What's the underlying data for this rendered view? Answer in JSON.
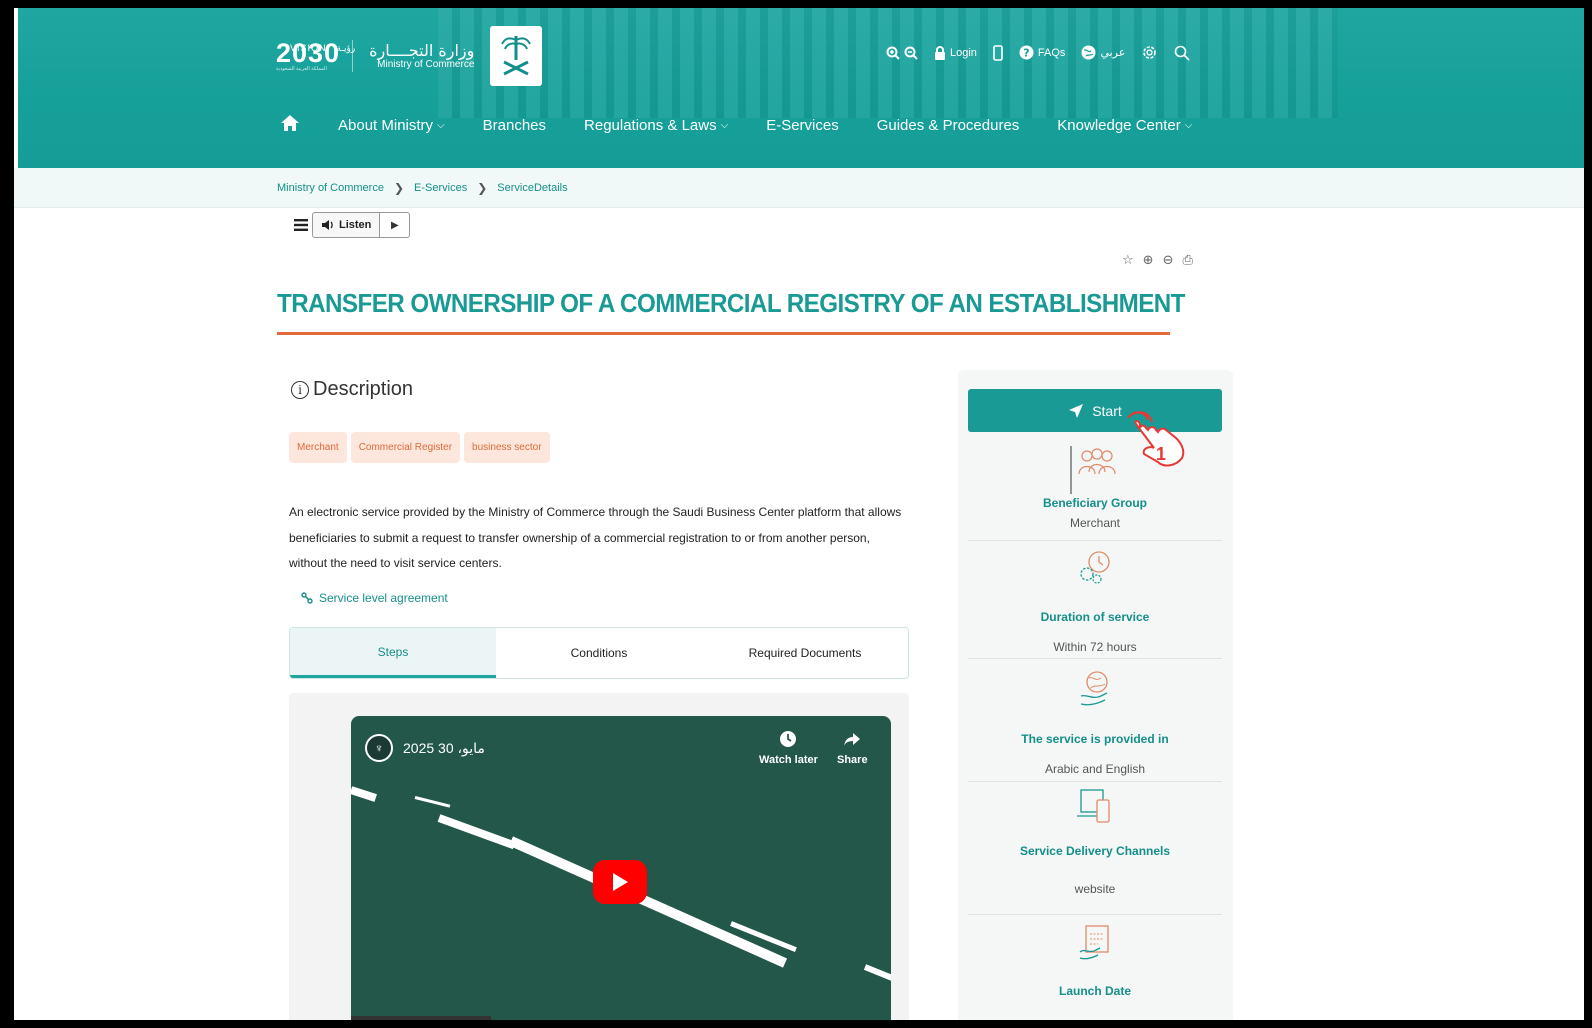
{
  "header": {
    "vision_top": "VISION",
    "vision_ar": "رؤيـة",
    "vision_num": "2030",
    "vision_sub": "المملكة العربية السعودية",
    "ministry_ar": "وزارة التجــــارة",
    "ministry_en": "Ministry of Commerce",
    "toolbar": {
      "login": "Login",
      "faqs": "FAQs",
      "language": "عربي"
    },
    "nav": [
      {
        "label": "About Ministry",
        "dropdown": true
      },
      {
        "label": "Branches",
        "dropdown": false
      },
      {
        "label": "Regulations & Laws",
        "dropdown": true
      },
      {
        "label": "E-Services",
        "dropdown": false
      },
      {
        "label": "Guides & Procedures",
        "dropdown": false
      },
      {
        "label": "Knowledge Center",
        "dropdown": true
      }
    ]
  },
  "breadcrumb": [
    "Ministry of Commerce",
    "E-Services",
    "ServiceDetails"
  ],
  "listen": {
    "label": "Listen"
  },
  "page": {
    "title": "TRANSFER OWNERSHIP OF A COMMERCIAL REGISTRY OF AN ESTABLISHMENT",
    "description_heading": "Description",
    "tags": [
      "Merchant",
      "Commercial Register",
      "business sector"
    ],
    "description_lines": [
      "An electronic service provided by the Ministry of Commerce through the Saudi Business Center platform that allows",
      "beneficiaries to submit a request to transfer ownership of a commercial registration to or from another person,",
      "without the need to visit service centers."
    ],
    "sla_link": "Service level agreement",
    "tabs": [
      {
        "label": "Steps",
        "active": true
      },
      {
        "label": "Conditions",
        "active": false
      },
      {
        "label": "Required Documents",
        "active": false
      }
    ]
  },
  "video": {
    "title": "مايو، 30 2025",
    "watch_later": "Watch later",
    "share": "Share"
  },
  "sidebar": {
    "start_label": "Start",
    "annotation_number": "1",
    "items": [
      {
        "label": "Beneficiary Group",
        "value": "Merchant",
        "icon": "group-icon"
      },
      {
        "label": "Duration of service",
        "value": "Within 72 hours",
        "icon": "clock-gear-icon"
      },
      {
        "label": "The service is provided in",
        "value": "Arabic and English",
        "icon": "globe-hand-icon"
      },
      {
        "label": "Service Delivery Channels",
        "value": "website",
        "icon": "devices-icon"
      },
      {
        "label": "Launch Date",
        "value": "",
        "icon": "calendar-icon"
      }
    ]
  },
  "colors": {
    "primary": "#1a9a95",
    "accent": "#e06a3b",
    "tag_bg": "#fde6dc"
  }
}
